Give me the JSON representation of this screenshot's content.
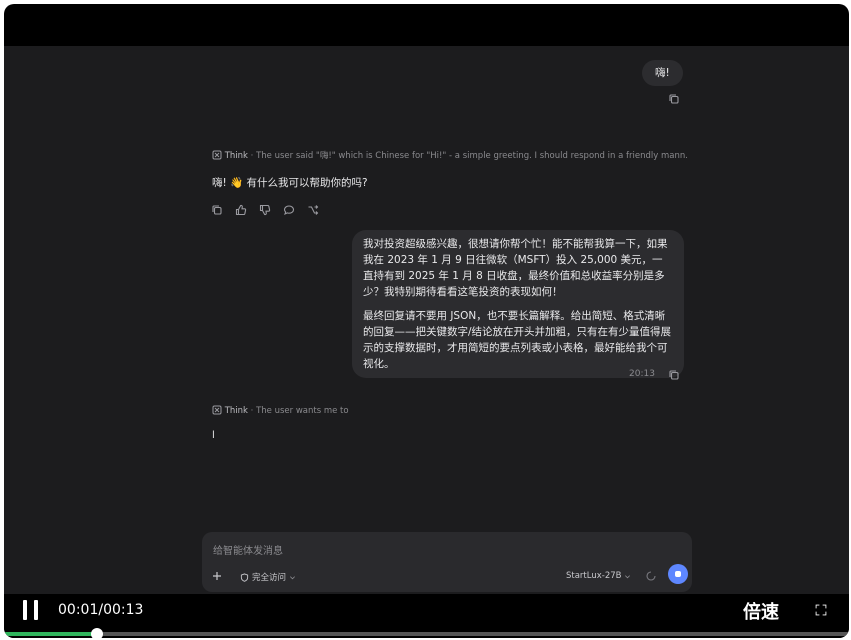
{
  "chat": {
    "user_msg_1": "嗨!",
    "think_1_label": "Think",
    "think_1_text": "The user said \"嗨!\" which is Chinese for \"Hi!\" - a simple greeting. I should respond in a friendly mann...",
    "assistant_reply_1": "嗨! 👋 有什么我可以帮助你的吗?",
    "user_msg_2_p1": "我对投资超级感兴趣，很想请你帮个忙！能不能帮我算一下，如果我在 2023 年 1 月 9 日往微软（MSFT）投入 25,000 美元，一直持有到 2025 年 1 月 8 日收盘，最终价值和总收益率分别是多少？我特别期待看看这笔投资的表现如何！",
    "user_msg_2_p2": "最终回复请不要用 JSON，也不要长篇解释。给出简短、格式清晰的回复——把关键数字/结论放在开头并加粗，只有在有少量值得展示的支撑数据时，才用简短的要点列表或小表格，最好能给我个可视化。",
    "user_msg_2_time": "20:13",
    "think_2_label": "Think",
    "think_2_text": "The user wants me to",
    "assistant_partial": "l"
  },
  "composer": {
    "placeholder": "给智能体发消息",
    "access_label": "完全访问",
    "model_label": "StartLux-27B"
  },
  "player": {
    "time": "00:01/00:13",
    "speed_label": "倍速",
    "progress": 0.11
  },
  "icons": {
    "copy": "copy-icon",
    "like": "thumbs-up-icon",
    "dislike": "thumbs-down-icon",
    "comment": "comment-icon",
    "branch": "branch-icon",
    "think": "think-icon",
    "plus": "plus-icon",
    "shield": "shield-icon",
    "pause": "pause-icon",
    "fullscreen": "fullscreen-icon"
  },
  "colors": {
    "accent": "#5e87ff",
    "progress": "#2fb55c",
    "bubble": "#2c2c2f",
    "background": "#1c1c1e"
  }
}
